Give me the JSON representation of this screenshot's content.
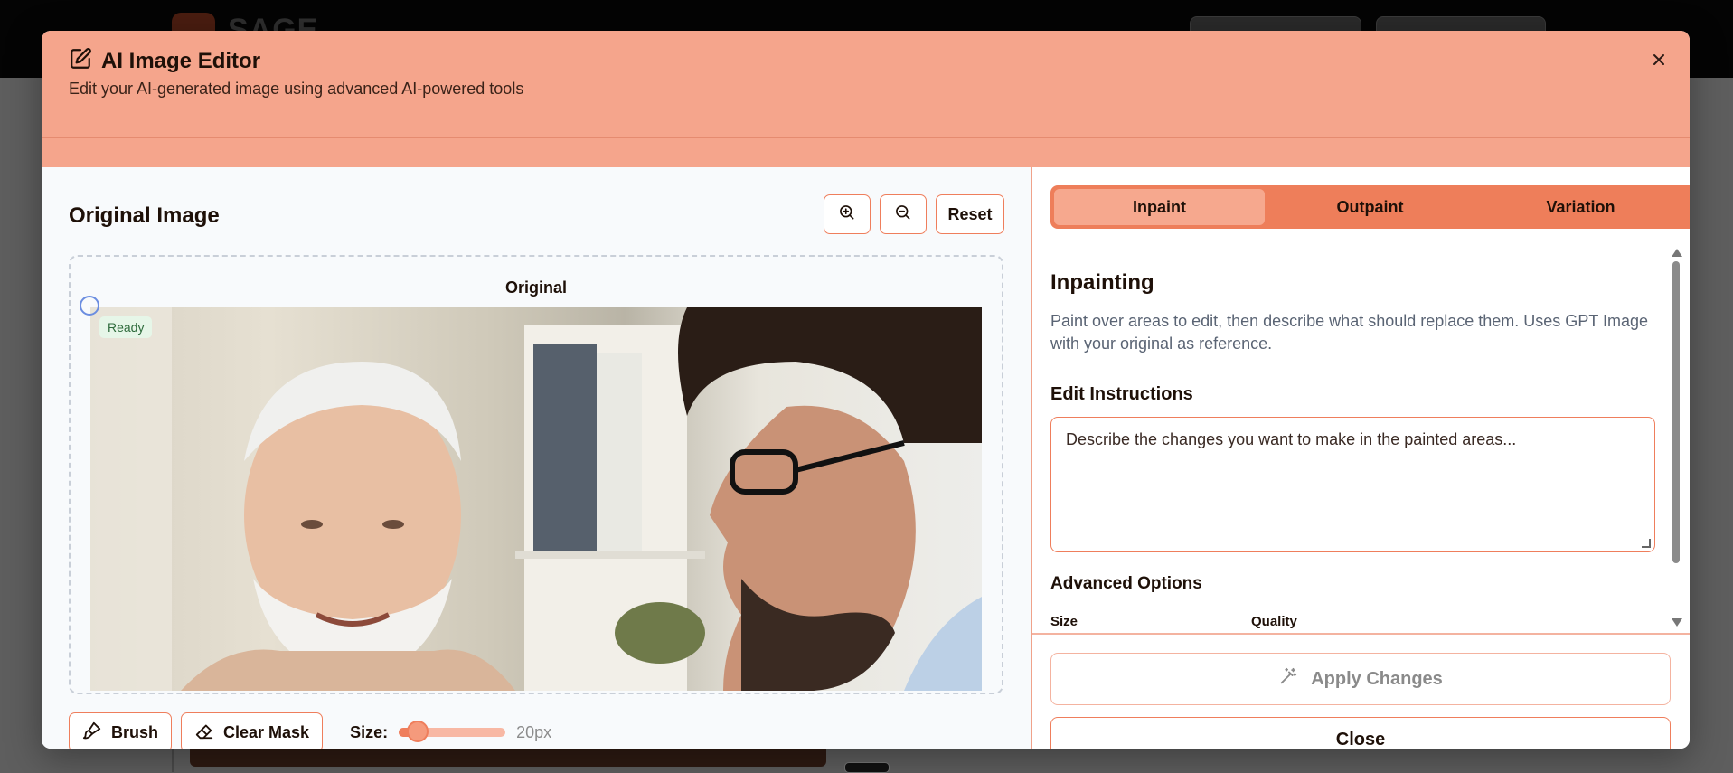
{
  "modal": {
    "title": "AI Image Editor",
    "subtitle": "Edit your AI-generated image using advanced AI-powered tools",
    "title_icon": "edit-icon",
    "close_icon": "close-icon"
  },
  "left": {
    "section_title": "Original Image",
    "zoom_in_icon": "zoom-in-icon",
    "zoom_out_icon": "zoom-out-icon",
    "reset_label": "Reset",
    "canvas_label": "Original",
    "status_badge": "Ready",
    "tools": {
      "brush_label": "Brush",
      "clear_mask_label": "Clear Mask",
      "size_label": "Size:",
      "size_value": "20px",
      "size_fraction": 0.18
    }
  },
  "right": {
    "tabs": [
      {
        "label": "Inpaint",
        "active": true
      },
      {
        "label": "Outpaint",
        "active": false
      },
      {
        "label": "Variation",
        "active": false
      }
    ],
    "heading": "Inpainting",
    "description": "Paint over areas to edit, then describe what should replace them. Uses GPT Image with your original as reference.",
    "instructions_label": "Edit Instructions",
    "instructions_placeholder": "Describe the changes you want to make in the painted areas...",
    "advanced_title": "Advanced Options",
    "options": {
      "size_label": "Size",
      "quality_label": "Quality"
    },
    "apply_label": "Apply Changes",
    "close_label": "Close"
  },
  "background": {
    "logo_text": "SAGE"
  },
  "colors": {
    "accent": "#ef7e5c",
    "header": "#f5a58c",
    "tab_active": "#f6a88e",
    "badge_bg": "#e6f6e8",
    "badge_text": "#2e6b3c"
  }
}
